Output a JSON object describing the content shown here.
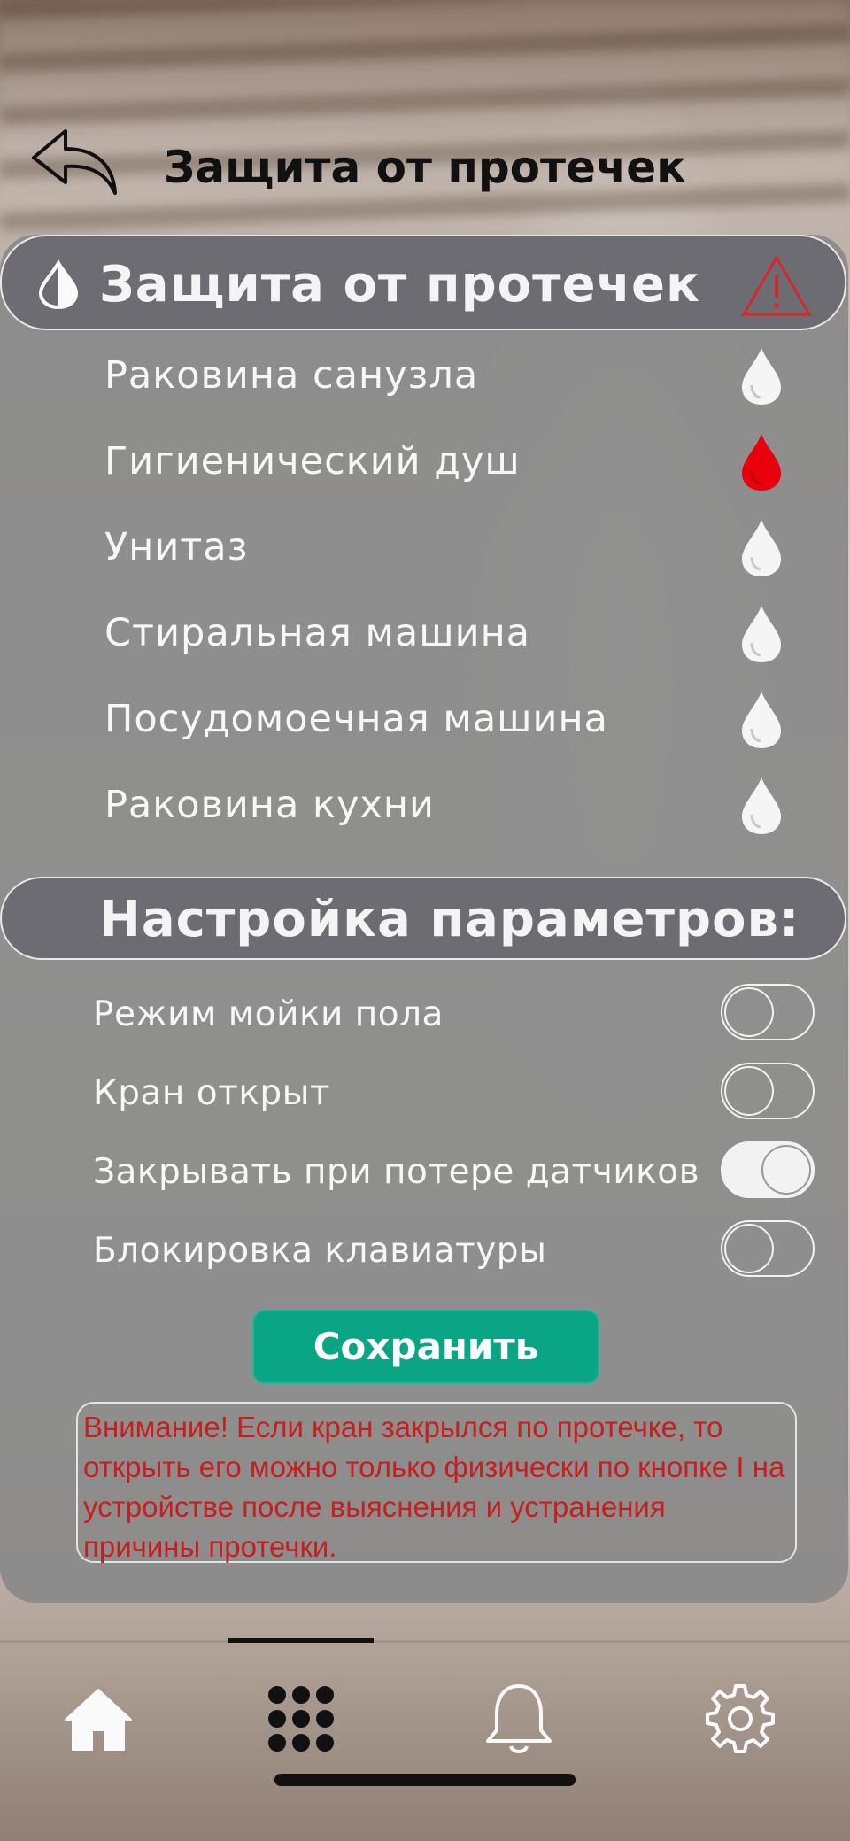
{
  "header": {
    "title": "Защита от протечек",
    "back_icon": "back-arrow-icon"
  },
  "leak_section": {
    "title": "Защита от протечек",
    "icon": "water-half-drop-icon",
    "alert_icon": "warning-triangle-icon",
    "alert_color": "#d22a2a",
    "sensors": [
      {
        "label": "Раковина санузла",
        "status": "ok",
        "color": "#f5f5f5"
      },
      {
        "label": "Гигиенический душ",
        "status": "leak",
        "color": "#e8000c"
      },
      {
        "label": "Унитаз",
        "status": "ok",
        "color": "#f5f5f5"
      },
      {
        "label": "Стиральная машина",
        "status": "ok",
        "color": "#f5f5f5"
      },
      {
        "label": "Посудомоечная машина",
        "status": "ok",
        "color": "#f5f5f5"
      },
      {
        "label": "Раковина кухни",
        "status": "ok",
        "color": "#f5f5f5"
      }
    ]
  },
  "settings_section": {
    "title": "Настройка параметров:",
    "items": [
      {
        "label": "Режим мойки пола",
        "on": false
      },
      {
        "label": "Кран открыт",
        "on": false
      },
      {
        "label": "Закрывать при потере датчиков",
        "on": true
      },
      {
        "label": "Блокировка клавиатуры",
        "on": false
      }
    ]
  },
  "save_button": {
    "label": "Сохранить",
    "color": "#0aa585"
  },
  "warning_text": "Внимание! Если кран закрылся по протечке, то открыть его можно только физически по кнопке I на устройстве после выяснения и устранения причины протечки.",
  "tabbar": {
    "tabs": [
      {
        "icon": "home-icon",
        "active": false
      },
      {
        "icon": "grid-icon",
        "active": true
      },
      {
        "icon": "bell-icon",
        "active": false
      },
      {
        "icon": "gear-icon",
        "active": false
      }
    ]
  }
}
